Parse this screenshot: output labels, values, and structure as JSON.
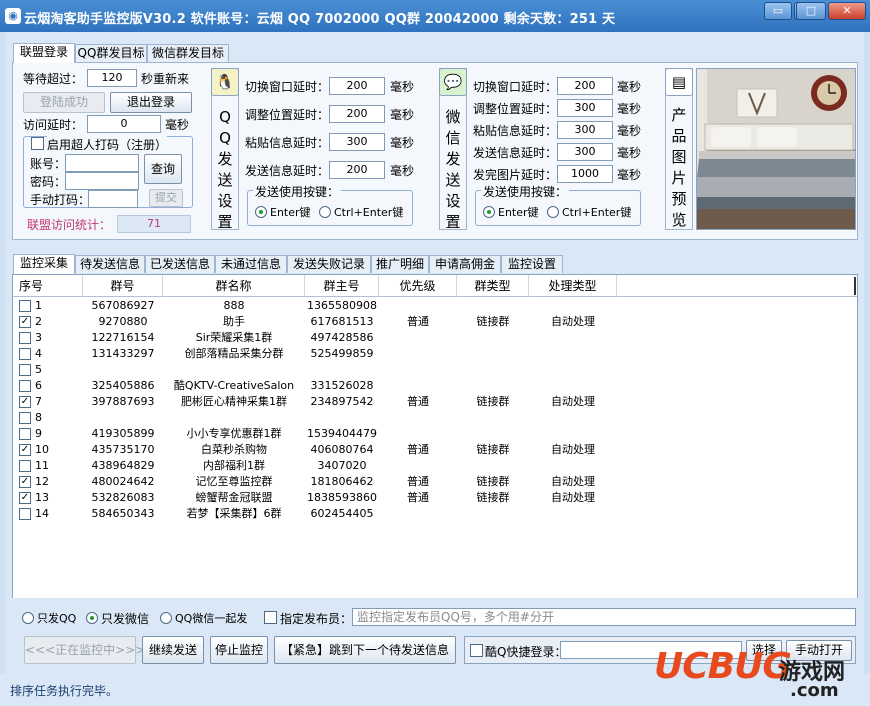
{
  "window": {
    "title": "云烟淘客助手监控版V30.2  软件账号：云烟  QQ 7002000  QQ群 20042000  剩余天数：251 天"
  },
  "top_tabs": [
    "联盟登录",
    "QQ群发目标",
    "微信群发目标"
  ],
  "login": {
    "wait_label": "等待超过：",
    "wait_value": "120",
    "wait_suffix": "秒重新来",
    "login_success_btn": "登陆成功",
    "logout_btn": "退出登录",
    "access_delay_label": "访问延时：",
    "access_delay_value": "0",
    "access_delay_unit": "毫秒",
    "captcha_enable_label": "启用超人打码（注册）",
    "account_label": "账号：",
    "password_label": "密码：",
    "manual_label": "手动打码：",
    "query_btn": "查询",
    "submit_btn": "提交",
    "stats_label": "联盟访问统计：",
    "stats_value": "71"
  },
  "qq_send": {
    "vertical_title": "QQ发送设置",
    "rows": [
      {
        "label": "切换窗口延时：",
        "value": "200",
        "unit": "毫秒"
      },
      {
        "label": "调整位置延时：",
        "value": "200",
        "unit": "毫秒"
      },
      {
        "label": "粘贴信息延时：",
        "value": "300",
        "unit": "毫秒"
      },
      {
        "label": "发送信息延时：",
        "value": "200",
        "unit": "毫秒"
      }
    ],
    "key_group_label": "发送使用按键：",
    "key_opt1": "Enter键",
    "key_opt2": "Ctrl+Enter键"
  },
  "wx_send": {
    "vertical_title": "微信发送设置",
    "rows": [
      {
        "label": "切换窗口延时：",
        "value": "200",
        "unit": "毫秒"
      },
      {
        "label": "调整位置延时：",
        "value": "300",
        "unit": "毫秒"
      },
      {
        "label": "粘贴信息延时：",
        "value": "300",
        "unit": "毫秒"
      },
      {
        "label": "发送信息延时：",
        "value": "300",
        "unit": "毫秒"
      },
      {
        "label": "发完图片延时：",
        "value": "1000",
        "unit": "毫秒"
      }
    ],
    "key_group_label": "发送使用按键：",
    "key_opt1": "Enter键",
    "key_opt2": "Ctrl+Enter键"
  },
  "preview": {
    "vertical_title": "产品图片预览"
  },
  "main_tabs": [
    "监控采集",
    "待发送信息",
    "已发送信息",
    "未通过信息",
    "发送失败记录",
    "推广明细",
    "申请高佣金",
    "监控设置"
  ],
  "grid": {
    "headers": [
      "序号",
      "群号",
      "群名称",
      "群主号",
      "优先级",
      "群类型",
      "处理类型"
    ],
    "rows": [
      {
        "checked": false,
        "no": "1",
        "group": "567086927",
        "name": "888",
        "owner": "1365580908",
        "priority": "",
        "type": "",
        "handle": ""
      },
      {
        "checked": true,
        "no": "2",
        "group": "9270880",
        "name": "助手",
        "owner": "617681513",
        "priority": "普通",
        "type": "链接群",
        "handle": "自动处理"
      },
      {
        "checked": false,
        "no": "3",
        "group": "122716154",
        "name": "Sir荣耀采集1群",
        "owner": "497428586",
        "priority": "",
        "type": "",
        "handle": ""
      },
      {
        "checked": false,
        "no": "4",
        "group": "131433297",
        "name": "创部落精品采集分群",
        "owner": "525499859",
        "priority": "",
        "type": "",
        "handle": ""
      },
      {
        "checked": false,
        "no": "5",
        "group": "",
        "name": "",
        "owner": "",
        "priority": "",
        "type": "",
        "handle": ""
      },
      {
        "checked": false,
        "no": "6",
        "group": "325405886",
        "name": "酷QKTV-CreativeSalon",
        "owner": "331526028",
        "priority": "",
        "type": "",
        "handle": ""
      },
      {
        "checked": true,
        "no": "7",
        "group": "397887693",
        "name": "肥彬匠心精神采集1群",
        "owner": "234897542",
        "priority": "普通",
        "type": "链接群",
        "handle": "自动处理"
      },
      {
        "checked": false,
        "no": "8",
        "group": "",
        "name": "",
        "owner": "",
        "priority": "",
        "type": "",
        "handle": ""
      },
      {
        "checked": false,
        "no": "9",
        "group": "419305899",
        "name": "小小专享优惠群1群",
        "owner": "1539404479",
        "priority": "",
        "type": "",
        "handle": ""
      },
      {
        "checked": true,
        "no": "10",
        "group": "435735170",
        "name": "白菜秒杀购物",
        "owner": "406080764",
        "priority": "普通",
        "type": "链接群",
        "handle": "自动处理"
      },
      {
        "checked": false,
        "no": "11",
        "group": "438964829",
        "name": "内部福利1群",
        "owner": "3407020",
        "priority": "",
        "type": "",
        "handle": ""
      },
      {
        "checked": true,
        "no": "12",
        "group": "480024642",
        "name": "记忆至尊监控群",
        "owner": "181806462",
        "priority": "普通",
        "type": "链接群",
        "handle": "自动处理"
      },
      {
        "checked": true,
        "no": "13",
        "group": "532826083",
        "name": "螃蟹帮金冠联盟",
        "owner": "1838593860",
        "priority": "普通",
        "type": "链接群",
        "handle": "自动处理"
      },
      {
        "checked": false,
        "no": "14",
        "group": "584650343",
        "name": "若梦【采集群】6群",
        "owner": "602454405",
        "priority": "",
        "type": "",
        "handle": ""
      }
    ]
  },
  "bottom": {
    "radio_qq": "只发QQ",
    "radio_wx": "只发微信",
    "radio_both": "QQ微信一起发",
    "assign_label": "指定发布员：",
    "assign_placeholder": "监控指定发布员QQ号，多个用#分开",
    "monitoring_btn": "<<<正在监控中>>>",
    "continue_btn": "继续发送",
    "stop_btn": "停止监控",
    "urgent_btn": "【紧急】跳到下一个待发送信息",
    "quick_login_label": "酷Q快捷登录：",
    "select_btn": "选择",
    "manual_open_btn": "手动打开"
  },
  "status": {
    "text": "排序任务执行完毕。"
  },
  "watermark": {
    "part1": "UCBUG",
    "part2": "游戏网",
    "part3": ".com"
  }
}
